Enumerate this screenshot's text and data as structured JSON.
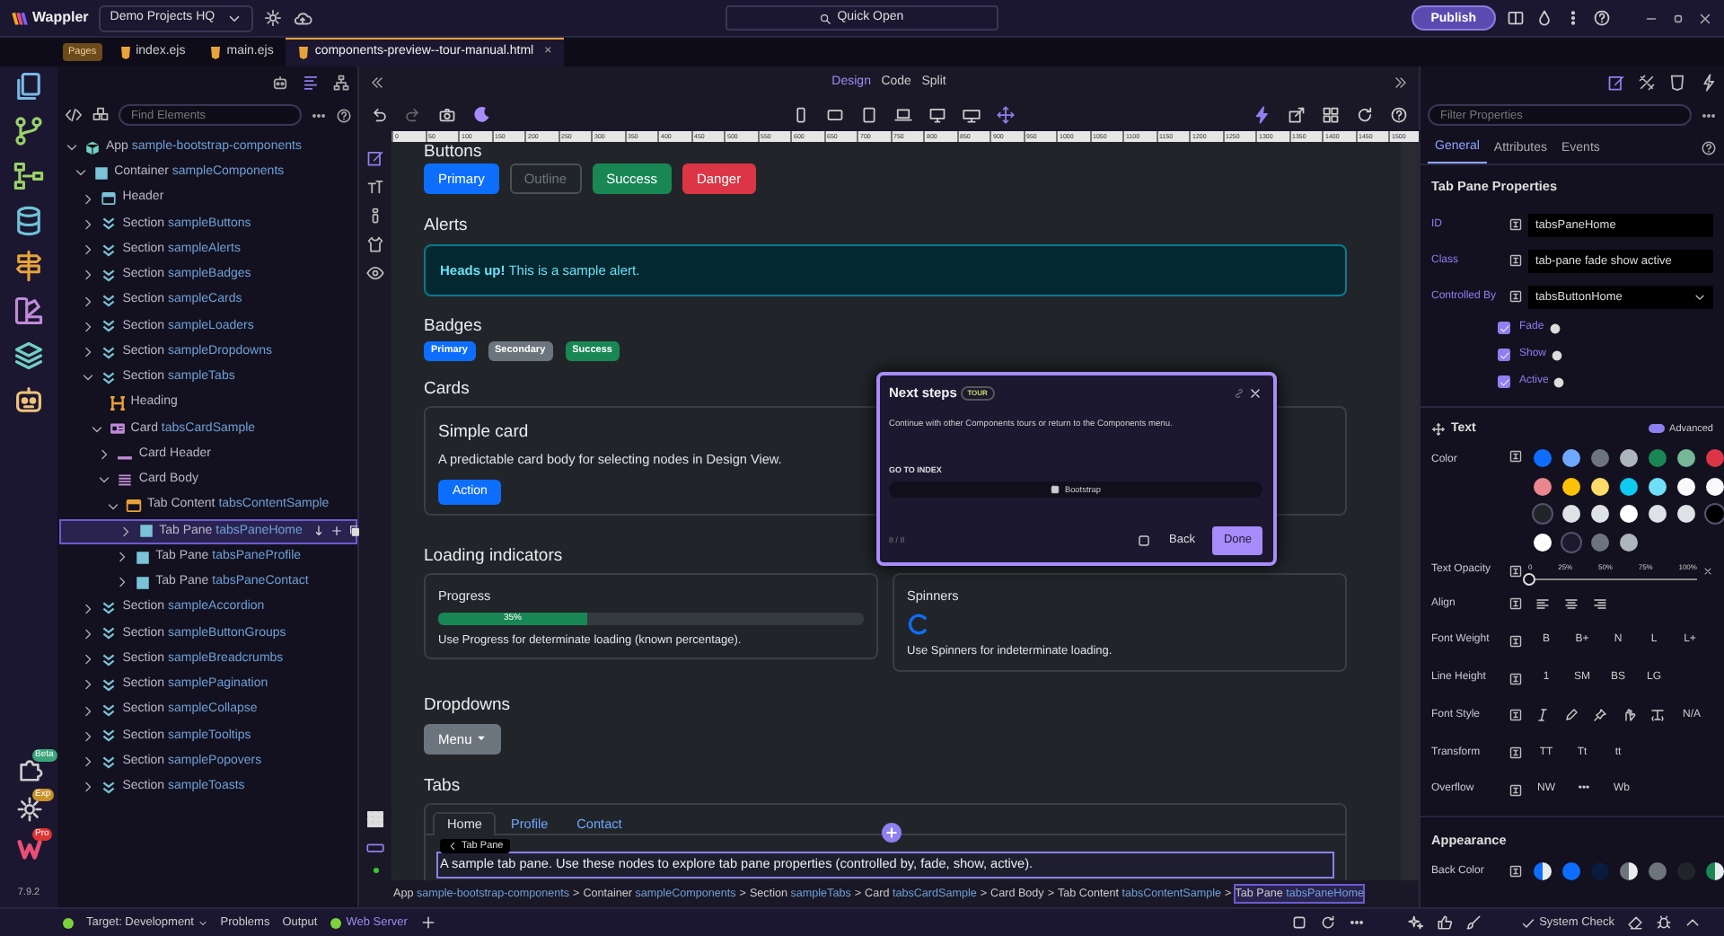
{
  "app": {
    "name": "Wappler",
    "project": "Demo Projects HQ",
    "quick_open": "Quick Open",
    "publish": "Publish"
  },
  "rail_badges": [
    "Beta",
    "Exp",
    "Pro"
  ],
  "pages_badge": "Pages",
  "file_tabs": [
    {
      "label": "index.ejs",
      "selected": false
    },
    {
      "label": "main.ejs",
      "selected": false
    },
    {
      "label": "components-preview--tour-manual.html",
      "selected": true
    }
  ],
  "close_mark": "×",
  "search": {
    "placeholder": "Find Elements"
  },
  "tree": [
    {
      "type": "App",
      "id": "sample-bootstrap-components",
      "kind": "app",
      "expanded": true,
      "selected": false,
      "children": [
        {
          "type": "Container",
          "id": "sampleComponents",
          "kind": "container",
          "expanded": true,
          "selected": false,
          "children": [
            {
              "type": "Header",
              "kind": "header",
              "expanded": false,
              "selected": false
            },
            {
              "type": "Section",
              "id": "sampleButtons",
              "kind": "section",
              "expanded": false,
              "selected": false
            },
            {
              "type": "Section",
              "id": "sampleAlerts",
              "kind": "section",
              "expanded": false,
              "selected": false
            },
            {
              "type": "Section",
              "id": "sampleBadges",
              "kind": "section",
              "expanded": false,
              "selected": false
            },
            {
              "type": "Section",
              "id": "sampleCards",
              "kind": "section",
              "expanded": false,
              "selected": false
            },
            {
              "type": "Section",
              "id": "sampleLoaders",
              "kind": "section",
              "expanded": false,
              "selected": false
            },
            {
              "type": "Section",
              "id": "sampleDropdowns",
              "kind": "section",
              "expanded": false,
              "selected": false
            },
            {
              "type": "Section",
              "id": "sampleTabs",
              "kind": "section",
              "expanded": true,
              "selected": false,
              "children": [
                {
                  "type": "Heading",
                  "kind": "heading",
                  "selected": false
                },
                {
                  "type": "Card",
                  "id": "tabsCardSample",
                  "kind": "card",
                  "expanded": true,
                  "selected": false,
                  "children": [
                    {
                      "type": "Card Header",
                      "kind": "card-header",
                      "expanded": false,
                      "selected": false
                    },
                    {
                      "type": "Card Body",
                      "kind": "card-body",
                      "expanded": true,
                      "selected": false,
                      "children": [
                        {
                          "type": "Tab Content",
                          "id": "tabsContentSample",
                          "kind": "tab-content",
                          "expanded": true,
                          "selected": false,
                          "children": [
                            {
                              "type": "Tab Pane",
                              "id": "tabsPaneHome",
                              "kind": "tab-pane",
                              "expanded": false,
                              "selected": true
                            },
                            {
                              "type": "Tab Pane",
                              "id": "tabsPaneProfile",
                              "kind": "tab-pane",
                              "expanded": false,
                              "selected": false
                            },
                            {
                              "type": "Tab Pane",
                              "id": "tabsPaneContact",
                              "kind": "tab-pane",
                              "expanded": false,
                              "selected": false
                            }
                          ]
                        }
                      ]
                    }
                  ]
                }
              ]
            },
            {
              "type": "Section",
              "id": "sampleAccordion",
              "kind": "section",
              "expanded": false,
              "selected": false
            },
            {
              "type": "Section",
              "id": "sampleButtonGroups",
              "kind": "section",
              "expanded": false,
              "selected": false
            },
            {
              "type": "Section",
              "id": "sampleBreadcrumbs",
              "kind": "section",
              "expanded": false,
              "selected": false
            },
            {
              "type": "Section",
              "id": "samplePagination",
              "kind": "section",
              "expanded": false,
              "selected": false
            },
            {
              "type": "Section",
              "id": "sampleCollapse",
              "kind": "section",
              "expanded": false,
              "selected": false
            },
            {
              "type": "Section",
              "id": "sampleTooltips",
              "kind": "section",
              "expanded": false,
              "selected": false
            },
            {
              "type": "Section",
              "id": "samplePopovers",
              "kind": "section",
              "expanded": false,
              "selected": false
            },
            {
              "type": "Section",
              "id": "sampleToasts",
              "kind": "section",
              "expanded": false,
              "selected": false
            }
          ]
        }
      ]
    }
  ],
  "view_modes": [
    {
      "label": "Design",
      "selected": true
    },
    {
      "label": "Code",
      "selected": false
    },
    {
      "label": "Split",
      "selected": false
    }
  ],
  "ruler": [
    "0",
    "50",
    "100",
    "150",
    "200",
    "250",
    "300",
    "350",
    "400",
    "450",
    "500",
    "550",
    "600",
    "650",
    "700",
    "750",
    "800",
    "850",
    "900",
    "950",
    "1000",
    "1050",
    "1100",
    "1150",
    "1200",
    "1250",
    "1300",
    "1350",
    "1400",
    "1450",
    "1500"
  ],
  "canvas": {
    "buttons_heading": "Buttons",
    "buttons": [
      {
        "label": "Primary",
        "kind": "primary"
      },
      {
        "label": "Outline",
        "kind": "outline"
      },
      {
        "label": "Success",
        "kind": "success"
      },
      {
        "label": "Danger",
        "kind": "danger"
      }
    ],
    "alerts_heading": "Alerts",
    "alert": "**Heads up!** This is a sample alert.",
    "badges_heading": "Badges",
    "badges": [
      {
        "label": "Primary",
        "kind": "primary"
      },
      {
        "label": "Secondary",
        "kind": "secondary"
      },
      {
        "label": "Success",
        "kind": "success"
      }
    ],
    "cards_heading": "Cards",
    "card": {
      "title": "Simple card",
      "text": "A predictable card body for selecting nodes in Design View.",
      "button": "Action"
    },
    "loading_heading": "Loading indicators",
    "progress": {
      "title": "Progress",
      "label": "35%",
      "level": 0.35,
      "text": "Use Progress for determinate loading (known percentage)."
    },
    "spinners": {
      "title": "Spinners",
      "text": "Use Spinners for indeterminate loading."
    },
    "dropdowns_heading": "Dropdowns",
    "dropdown": "Menu",
    "tabs_heading": "Tabs",
    "tabs": [
      {
        "label": "Home",
        "selected": true
      },
      {
        "label": "Profile",
        "selected": false
      },
      {
        "label": "Contact",
        "selected": false
      }
    ],
    "pane_text": "A sample tab pane. Use these nodes to explore tab pane properties (controlled by, fade, show, active).",
    "tooltip": "Tab Pane"
  },
  "tour": {
    "title": "Next steps",
    "badge": "TOUR",
    "text": "Continue with other Components tours or return to the Components menu.",
    "section": "GO TO INDEX",
    "link": "Bootstrap",
    "counter": "8 / 8",
    "back": "Back",
    "done": "Done"
  },
  "breadcrumb": [
    {
      "type": "App",
      "id": "sample-bootstrap-components",
      "selected": false
    },
    {
      "type": "Container",
      "id": "sampleComponents",
      "selected": false
    },
    {
      "type": "Section",
      "id": "sampleTabs",
      "selected": false
    },
    {
      "type": "Card",
      "id": "tabsCardSample",
      "selected": false
    },
    {
      "type": "Card Body",
      "selected": false
    },
    {
      "type": "Tab Content",
      "id": "tabsContentSample",
      "selected": false
    },
    {
      "type": "Tab Pane",
      "id": "tabsPaneHome",
      "selected": true
    }
  ],
  "breadcrumb_separator": ">",
  "properties": {
    "filter_placeholder": "Filter Properties",
    "tabs": [
      {
        "label": "General",
        "selected": true
      },
      {
        "label": "Attributes",
        "selected": false
      },
      {
        "label": "Events",
        "selected": false
      }
    ],
    "heading": "Tab Pane Properties",
    "fields": [
      {
        "label": "ID",
        "value": "tabsPaneHome",
        "kind": "text"
      },
      {
        "label": "Class",
        "value": "tab-pane fade show active",
        "kind": "text"
      },
      {
        "label": "Controlled By",
        "value": "tabsButtonHome",
        "kind": "select"
      }
    ],
    "checks": [
      {
        "label": "Fade",
        "checked": true
      },
      {
        "label": "Show",
        "checked": true
      },
      {
        "label": "Active",
        "checked": true
      }
    ],
    "text_heading": "Text",
    "advanced": {
      "label": "Advanced",
      "on": true
    },
    "color_label": "Color",
    "text_colors": [
      {
        "color": "#0d6efd"
      },
      {
        "color": "#6ea8fe"
      },
      {
        "color": "#6c757d"
      },
      {
        "color": "#adb5bd"
      },
      {
        "color": "#198754"
      },
      {
        "color": "#75b798"
      },
      {
        "color": "#dc3545"
      },
      {
        "color": "#ea868f"
      },
      {
        "color": "#ffc107"
      },
      {
        "color": "#ffda6a"
      },
      {
        "color": "#0dcaf0"
      },
      {
        "color": "#6edff6"
      },
      {
        "color": "#f8f9fa"
      },
      {
        "color": "#f8f9fa"
      },
      {
        "color": "#212529"
      },
      {
        "color": "#dee2e6"
      },
      {
        "color": "#dee2e6"
      },
      {
        "color": "#ffffff"
      },
      {
        "color": "#dee2e6"
      },
      {
        "color": "#dee2e6"
      },
      {
        "color": "#000000"
      },
      {
        "color": "#ffffff"
      },
      {
        "color": "#1c1a2c"
      },
      {
        "color": "#6c757d"
      },
      {
        "color": "#adb5bd"
      }
    ],
    "opacity": {
      "label": "Text Opacity",
      "ticks": [
        "0",
        "25%",
        "50%",
        "75%",
        "100%"
      ],
      "level": 0
    },
    "rows": [
      {
        "label": "Align",
        "kind": "align"
      },
      {
        "label": "Font Weight",
        "kind": "texts",
        "options": [
          "B",
          "B+",
          "N",
          "L",
          "L+"
        ]
      },
      {
        "label": "Line Height",
        "kind": "texts",
        "options": [
          "1",
          "SM",
          "BS",
          "LG"
        ]
      },
      {
        "label": "Font Style",
        "kind": "font-style",
        "options": [
          "N/A"
        ]
      },
      {
        "label": "Transform",
        "kind": "texts",
        "options": [
          "TT",
          "Tt",
          "tt"
        ]
      },
      {
        "label": "Overflow",
        "kind": "texts",
        "options": [
          "NW",
          "•••",
          "Wb"
        ]
      }
    ],
    "appearance_heading": "Appearance",
    "back_color_label": "Back Color",
    "back_colors": [
      {
        "color": "#0d6efd",
        "kind": "split"
      },
      {
        "color": "#0d6efd",
        "kind": "solid"
      },
      {
        "color": "#0b1b3d",
        "kind": "solid"
      },
      {
        "color": "#6c757d",
        "kind": "split"
      },
      {
        "color": "#6c757d",
        "kind": "solid"
      },
      {
        "color": "#212529",
        "kind": "solid"
      },
      {
        "color": "#198754",
        "kind": "split"
      }
    ]
  },
  "status": {
    "version": "7.9.2",
    "target": "Target: Development",
    "problems": "Problems",
    "output": "Output",
    "server": "Web Server",
    "system_check": "System Check"
  }
}
